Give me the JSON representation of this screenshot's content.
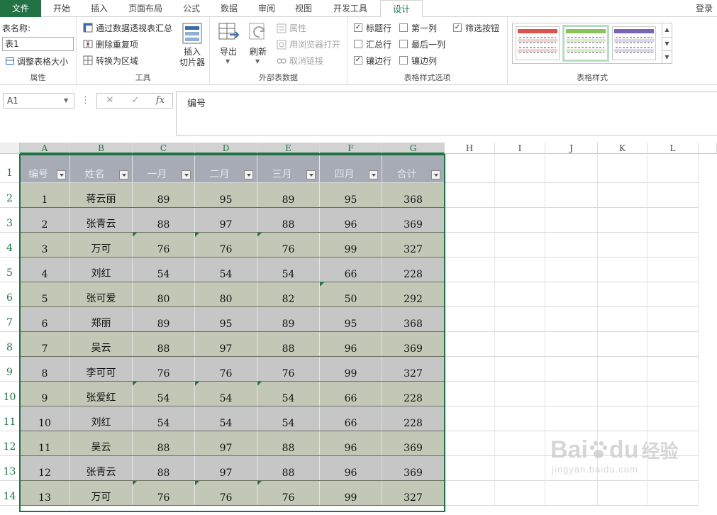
{
  "tabs": [
    "文件",
    "开始",
    "插入",
    "页面布局",
    "公式",
    "数据",
    "审阅",
    "视图",
    "开发工具",
    "设计"
  ],
  "login": "登录",
  "ribbon": {
    "props": {
      "name_label": "表名称:",
      "name_value": "表1",
      "resize": "调整表格大小",
      "group": "属性"
    },
    "tools": {
      "pivot": "通过数据透视表汇总",
      "dedupe": "删除重复项",
      "convert": "转换为区域",
      "slicer_l1": "插入",
      "slicer_l2": "切片器",
      "group": "工具"
    },
    "external": {
      "export": "导出",
      "refresh": "刷新",
      "props": "属性",
      "browser": "用浏览器打开",
      "unlink": "取消链接",
      "group": "外部表数据"
    },
    "options": {
      "header_row": "标题行",
      "first_col": "第一列",
      "filter_btn": "筛选按钮",
      "total_row": "汇总行",
      "last_col": "最后一列",
      "banded_rows": "镶边行",
      "banded_cols": "镶边列",
      "group": "表格样式选项"
    },
    "styles": {
      "group": "表格样式"
    }
  },
  "formula_bar": {
    "cell_ref": "A1",
    "fx": "fx",
    "content": "编号"
  },
  "sheet": {
    "columns": [
      "A",
      "B",
      "C",
      "D",
      "E",
      "F",
      "G",
      "H",
      "I",
      "J",
      "K",
      "L"
    ],
    "rows": [
      "1",
      "2",
      "3",
      "4",
      "5",
      "6",
      "7",
      "8",
      "9",
      "10",
      "11",
      "12",
      "13",
      "14"
    ],
    "headers": [
      "编号",
      "姓名",
      "一月",
      "二月",
      "三月",
      "四月",
      "合计"
    ],
    "data": [
      [
        "1",
        "蒋云丽",
        "89",
        "95",
        "89",
        "95",
        "368"
      ],
      [
        "2",
        "张青云",
        "88",
        "97",
        "88",
        "96",
        "369"
      ],
      [
        "3",
        "万可",
        "76",
        "76",
        "76",
        "99",
        "327"
      ],
      [
        "4",
        "刘红",
        "54",
        "54",
        "54",
        "66",
        "228"
      ],
      [
        "5",
        "张可爱",
        "80",
        "80",
        "82",
        "50",
        "292"
      ],
      [
        "6",
        "郑丽",
        "89",
        "95",
        "89",
        "95",
        "368"
      ],
      [
        "7",
        "吴云",
        "88",
        "97",
        "88",
        "96",
        "369"
      ],
      [
        "8",
        "李可可",
        "76",
        "76",
        "76",
        "99",
        "327"
      ],
      [
        "9",
        "张爱红",
        "54",
        "54",
        "54",
        "66",
        "228"
      ],
      [
        "10",
        "刘红",
        "54",
        "54",
        "54",
        "66",
        "228"
      ],
      [
        "11",
        "吴云",
        "88",
        "97",
        "88",
        "96",
        "369"
      ],
      [
        "12",
        "张青云",
        "88",
        "97",
        "88",
        "96",
        "369"
      ],
      [
        "13",
        "万可",
        "76",
        "76",
        "76",
        "99",
        "327"
      ]
    ]
  },
  "watermark": {
    "brand": "Bai",
    "brand2": "du",
    "cn": "经验",
    "url": "jingyan.baidu.com"
  },
  "colors": {
    "accent": "#217346",
    "header_fill": "#a7abb5",
    "band_a": "#c3c7b5",
    "band_b": "#c6c6c6"
  }
}
